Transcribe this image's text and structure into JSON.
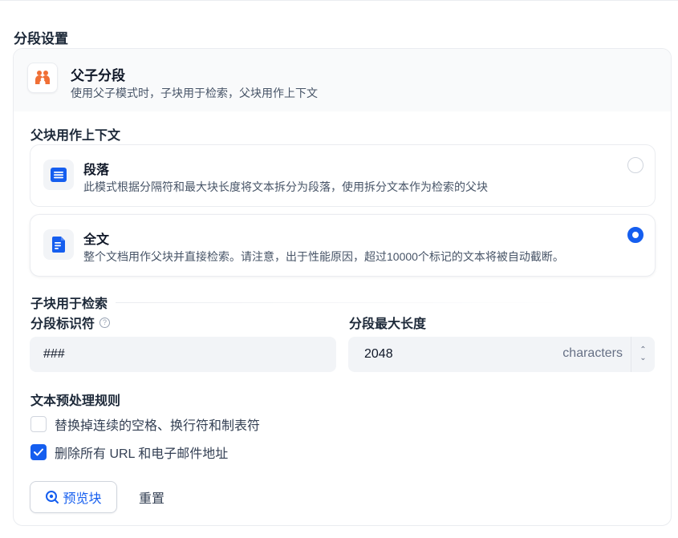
{
  "section_title": "分段设置",
  "mode": {
    "title": "父子分段",
    "description": "使用父子模式时，子块用于检索，父块用作上下文"
  },
  "parent": {
    "label": "父块用作上下文",
    "options": [
      {
        "title": "段落",
        "description": "此模式根据分隔符和最大块长度将文本拆分为段落，使用拆分文本作为检索的父块",
        "selected": false
      },
      {
        "title": "全文",
        "description": "整个文档用作父块并直接检索。请注意，出于性能原因，超过10000个标记的文本将被自动截断。",
        "selected": true
      }
    ]
  },
  "child": {
    "label": "子块用于检索",
    "separator_label": "分段标识符",
    "separator_value": "###",
    "max_length_label": "分段最大长度",
    "max_length_value": "2048",
    "max_length_unit": "characters"
  },
  "rules": {
    "label": "文本预处理规则",
    "items": [
      {
        "label": "替换掉连续的空格、换行符和制表符",
        "checked": false
      },
      {
        "label": "删除所有 URL 和电子邮件地址",
        "checked": true
      }
    ]
  },
  "actions": {
    "preview_label": "预览块",
    "reset_label": "重置"
  },
  "colors": {
    "accent": "#155eef",
    "mode_icon": "#f06f35"
  },
  "icons": {
    "mode": "parent-child-icon",
    "paragraph": "paragraph-icon",
    "fulltext": "document-icon",
    "help": "help-icon",
    "preview": "search-icon",
    "stepper": "chevron-updown-icon"
  }
}
